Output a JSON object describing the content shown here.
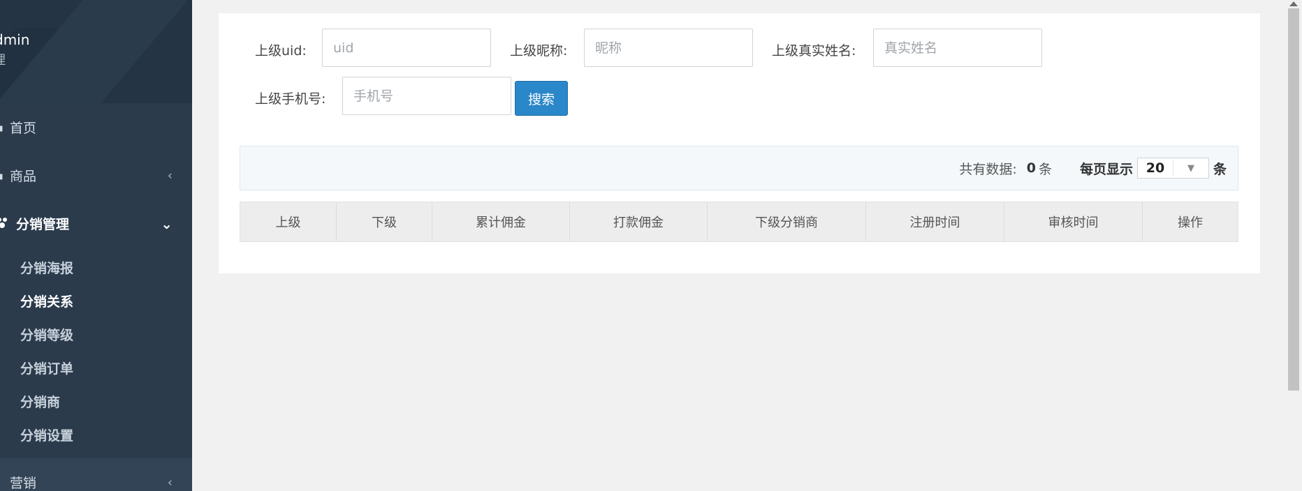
{
  "sidebar": {
    "profile": {
      "name": "dmin",
      "role": "理"
    },
    "menu": [
      {
        "icon": "home-icon",
        "label": "首页",
        "chevron": ""
      },
      {
        "icon": "goods-icon",
        "label": "商品",
        "chevron": "‹"
      },
      {
        "icon": "distribution-icon",
        "label": "分销管理",
        "chevron": "⌄"
      }
    ],
    "submenu": [
      {
        "label": "分销海报"
      },
      {
        "label": "分销关系"
      },
      {
        "label": "分销等级"
      },
      {
        "label": "分销订单"
      },
      {
        "label": "分销商"
      },
      {
        "label": "分销设置"
      }
    ],
    "bottom": {
      "label": "营销",
      "chevron": "‹"
    }
  },
  "filters": {
    "uid": {
      "label": "上级uid:",
      "placeholder": "uid"
    },
    "nickname": {
      "label": "上级昵称:",
      "placeholder": "昵称"
    },
    "realname": {
      "label": "上级真实姓名:",
      "placeholder": "真实姓名"
    },
    "phone": {
      "label": "上级手机号:",
      "placeholder": "手机号"
    },
    "search_label": "搜索"
  },
  "info": {
    "total_label": "共有数据:",
    "total_count": "0",
    "total_unit": "条",
    "per_page_label": "每页显示",
    "per_page_value": "20",
    "per_page_unit": "条"
  },
  "table": {
    "headers": [
      "上级",
      "下级",
      "累计佣金",
      "打款佣金",
      "下级分销商",
      "注册时间",
      "审核时间",
      "操作"
    ]
  },
  "colors": {
    "sidebar_bg": "#2b3b4c",
    "accent": "#2a87c9"
  }
}
